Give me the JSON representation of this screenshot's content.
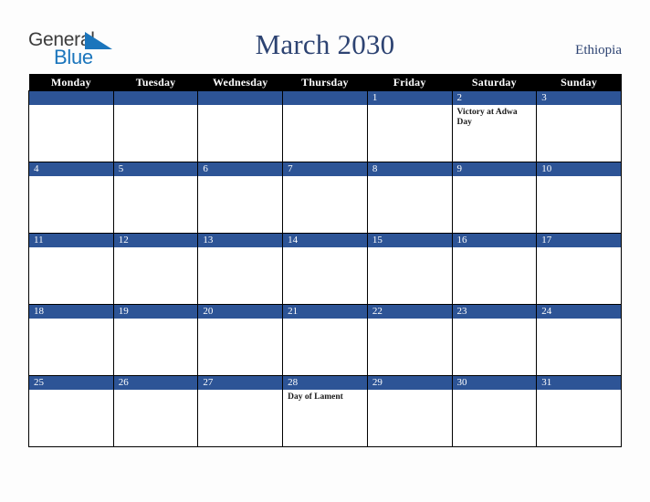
{
  "brand": {
    "name_part1": "General",
    "name_part2": "Blue",
    "triangle_icon": "blue-triangle-icon",
    "color_dark": "#3c3c3c",
    "color_blue": "#1b75bc"
  },
  "header": {
    "title": "March 2030",
    "country": "Ethiopia",
    "title_color": "#2d4372"
  },
  "colors": {
    "date_bar": "#2d5496",
    "header_row": "#000000",
    "page_background": "#fdfdfd",
    "cell_background": "#ffffff",
    "grid_line": "#000000"
  },
  "calendar": {
    "month": "March",
    "year": "2030",
    "weekday_headers": [
      "Monday",
      "Tuesday",
      "Wednesday",
      "Thursday",
      "Friday",
      "Saturday",
      "Sunday"
    ],
    "weeks": [
      [
        {
          "date": "",
          "events": []
        },
        {
          "date": "",
          "events": []
        },
        {
          "date": "",
          "events": []
        },
        {
          "date": "",
          "events": []
        },
        {
          "date": "1",
          "events": []
        },
        {
          "date": "2",
          "events": [
            "Victory at Adwa Day"
          ]
        },
        {
          "date": "3",
          "events": []
        }
      ],
      [
        {
          "date": "4",
          "events": []
        },
        {
          "date": "5",
          "events": []
        },
        {
          "date": "6",
          "events": []
        },
        {
          "date": "7",
          "events": []
        },
        {
          "date": "8",
          "events": []
        },
        {
          "date": "9",
          "events": []
        },
        {
          "date": "10",
          "events": []
        }
      ],
      [
        {
          "date": "11",
          "events": []
        },
        {
          "date": "12",
          "events": []
        },
        {
          "date": "13",
          "events": []
        },
        {
          "date": "14",
          "events": []
        },
        {
          "date": "15",
          "events": []
        },
        {
          "date": "16",
          "events": []
        },
        {
          "date": "17",
          "events": []
        }
      ],
      [
        {
          "date": "18",
          "events": []
        },
        {
          "date": "19",
          "events": []
        },
        {
          "date": "20",
          "events": []
        },
        {
          "date": "21",
          "events": []
        },
        {
          "date": "22",
          "events": []
        },
        {
          "date": "23",
          "events": []
        },
        {
          "date": "24",
          "events": []
        }
      ],
      [
        {
          "date": "25",
          "events": []
        },
        {
          "date": "26",
          "events": []
        },
        {
          "date": "27",
          "events": []
        },
        {
          "date": "28",
          "events": [
            "Day of Lament"
          ]
        },
        {
          "date": "29",
          "events": []
        },
        {
          "date": "30",
          "events": []
        },
        {
          "date": "31",
          "events": []
        }
      ]
    ]
  }
}
